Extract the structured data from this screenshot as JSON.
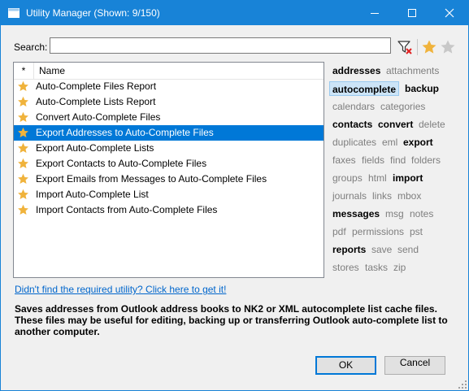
{
  "window": {
    "title": "Utility Manager (Shown: 9/150)",
    "accent": "#1883d7",
    "controls": [
      "minimize-icon",
      "maximize-icon",
      "close-icon"
    ]
  },
  "search": {
    "label": "Search:",
    "value": ""
  },
  "list": {
    "header_star": "*",
    "header_name": "Name",
    "selected_color": "#0078d7",
    "items": [
      {
        "name": "Auto-Complete Files Report",
        "starred": true
      },
      {
        "name": "Auto-Complete Lists Report",
        "starred": true
      },
      {
        "name": "Convert Auto-Complete Files",
        "starred": true
      },
      {
        "name": "Export Addresses to Auto-Complete Files",
        "starred": true,
        "selected": true
      },
      {
        "name": "Export Auto-Complete Lists",
        "starred": true
      },
      {
        "name": "Export Contacts to Auto-Complete Files",
        "starred": true
      },
      {
        "name": "Export Emails from Messages to Auto-Complete Files",
        "starred": true
      },
      {
        "name": "Import Auto-Complete List",
        "starred": true
      },
      {
        "name": "Import Contacts from Auto-Complete Files",
        "starred": true
      }
    ]
  },
  "tags": [
    [
      "addresses",
      "bold"
    ],
    [
      "attachments",
      "gray"
    ],
    [
      "autocomplete",
      "active"
    ],
    [
      "backup",
      "bold"
    ],
    [
      "calendars",
      "gray"
    ],
    [
      "categories",
      "gray"
    ],
    [
      "contacts",
      "bold"
    ],
    [
      "convert",
      "bold"
    ],
    [
      "delete",
      "gray"
    ],
    [
      "duplicates",
      "gray"
    ],
    [
      "eml",
      "gray"
    ],
    [
      "export",
      "bold"
    ],
    [
      "faxes",
      "gray"
    ],
    [
      "fields",
      "gray"
    ],
    [
      "find",
      "gray"
    ],
    [
      "folders",
      "gray"
    ],
    [
      "groups",
      "gray"
    ],
    [
      "html",
      "gray"
    ],
    [
      "import",
      "bold"
    ],
    [
      "journals",
      "gray"
    ],
    [
      "links",
      "gray"
    ],
    [
      "mbox",
      "gray"
    ],
    [
      "messages",
      "bold"
    ],
    [
      "msg",
      "gray"
    ],
    [
      "notes",
      "gray"
    ],
    [
      "pdf",
      "gray"
    ],
    [
      "permissions",
      "gray"
    ],
    [
      "pst",
      "gray"
    ],
    [
      "reports",
      "bold"
    ],
    [
      "save",
      "gray"
    ],
    [
      "send",
      "gray"
    ],
    [
      "stores",
      "gray"
    ],
    [
      "tasks",
      "gray"
    ],
    [
      "zip",
      "gray"
    ]
  ],
  "link_text": "Didn't find the required utility? Click here to get it!",
  "description": "Saves addresses from Outlook address books to NK2 or XML autocomplete list cache files. These files may be useful for editing, backing up or transferring Outlook auto-complete list to another computer.",
  "buttons": {
    "ok": "OK",
    "cancel": "Cancel"
  }
}
